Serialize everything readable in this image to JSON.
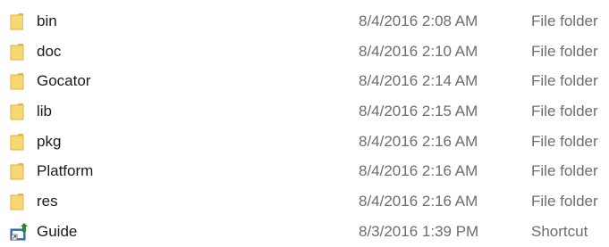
{
  "files": [
    {
      "name": "bin",
      "date_modified": "8/4/2016 2:08 AM",
      "type": "File folder",
      "icon": "folder-icon"
    },
    {
      "name": "doc",
      "date_modified": "8/4/2016 2:10 AM",
      "type": "File folder",
      "icon": "folder-icon"
    },
    {
      "name": "Gocator",
      "date_modified": "8/4/2016 2:14 AM",
      "type": "File folder",
      "icon": "folder-icon"
    },
    {
      "name": "lib",
      "date_modified": "8/4/2016 2:15 AM",
      "type": "File folder",
      "icon": "folder-icon"
    },
    {
      "name": "pkg",
      "date_modified": "8/4/2016 2:16 AM",
      "type": "File folder",
      "icon": "folder-icon"
    },
    {
      "name": "Platform",
      "date_modified": "8/4/2016 2:16 AM",
      "type": "File folder",
      "icon": "folder-icon"
    },
    {
      "name": "res",
      "date_modified": "8/4/2016 2:16 AM",
      "type": "File folder",
      "icon": "folder-icon"
    },
    {
      "name": "Guide",
      "date_modified": "8/3/2016 1:39 PM",
      "type": "Shortcut",
      "icon": "shortcut-icon"
    }
  ],
  "colors": {
    "folder_body": "#f8d775",
    "folder_tab": "#e6b946",
    "name_text": "#1a1a1a",
    "meta_text": "#6d6d6d",
    "shortcut_arrow": "#2b8a2b"
  }
}
